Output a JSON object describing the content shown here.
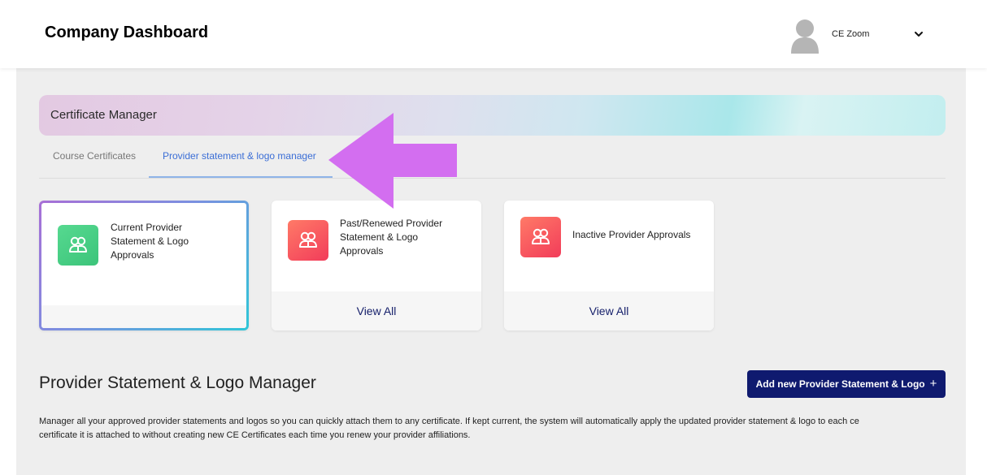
{
  "header": {
    "title": "Company Dashboard",
    "user_name": "CE Zoom"
  },
  "banner": {
    "title": "Certificate Manager"
  },
  "tabs": [
    {
      "label": "Course Certificates",
      "active": false
    },
    {
      "label": "Provider statement & logo manager",
      "active": true
    }
  ],
  "cards": [
    {
      "title": "Current Provider Statement & Logo Approvals",
      "lines": [
        "Current Provider",
        "Statement & Logo",
        "Approvals"
      ],
      "icon": "users-icon",
      "color": "#3cc47a",
      "selected": true,
      "footer": ""
    },
    {
      "title": "Past/Renewed Provider Statement & Logo Approvals",
      "lines": [
        "Past/Renewed Provider",
        "Statement & Logo",
        "Approvals"
      ],
      "icon": "users-icon",
      "color": "#f23c5a",
      "selected": false,
      "footer": "View All"
    },
    {
      "title": "Inactive Provider Approvals",
      "lines": [
        "Inactive Provider Approvals"
      ],
      "icon": "users-icon",
      "color": "#f23c5a",
      "selected": false,
      "footer": "View All"
    }
  ],
  "section": {
    "title": "Provider Statement & Logo Manager",
    "add_button": "Add new Provider Statement & Logo",
    "add_button_icon": "+",
    "description_line1": "Manager all your approved provider statements and logos so you can quickly attach them to any certificate. If kept current, the system will automatically apply the updated provider statement & logo to each ce",
    "description_line2": "certificate it is attached to without creating new CE Certificates each time you renew your provider affiliations."
  },
  "colors": {
    "accent_navy": "#0f1a6f",
    "active_tab": "#3b6ed6",
    "annotation_arrow": "#d36ef0"
  }
}
